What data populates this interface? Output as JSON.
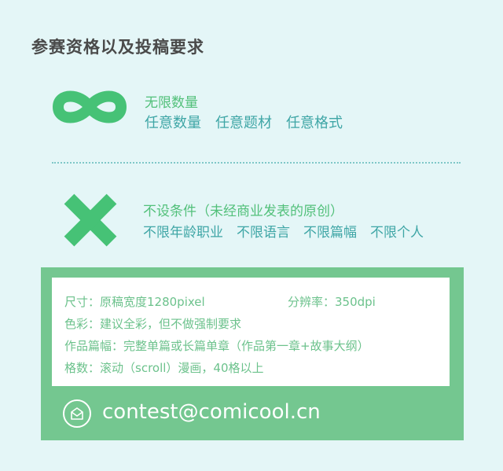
{
  "title": "参赛资格以及投稿要求",
  "section1": {
    "heading": "无限数量",
    "items": "任意数量　任意题材　任意格式",
    "icon": "infinity-icon"
  },
  "section2": {
    "heading": "不设条件（未经商业发表的原创）",
    "items": "不限年龄职业　不限语言　不限篇幅　不限个人",
    "icon": "cross-icon"
  },
  "requirements": {
    "size_label": "尺寸：原稿宽度1280pixel",
    "resolution_label": "分辨率：350dpi",
    "color_label": "色彩：建议全彩，但不做强制要求",
    "length_label": "作品篇幅：完整单篇或长篇单章（作品第一章+故事大纲）",
    "format_label": "格数：滚动（scroll）漫画，40格以上"
  },
  "contact": {
    "email": "contest@comicool.cn",
    "icon": "mail-icon"
  },
  "colors": {
    "background": "#e4f6f7",
    "accent_green": "#52c07a",
    "accent_teal": "#3fa6a6",
    "panel_green": "#74c790"
  }
}
